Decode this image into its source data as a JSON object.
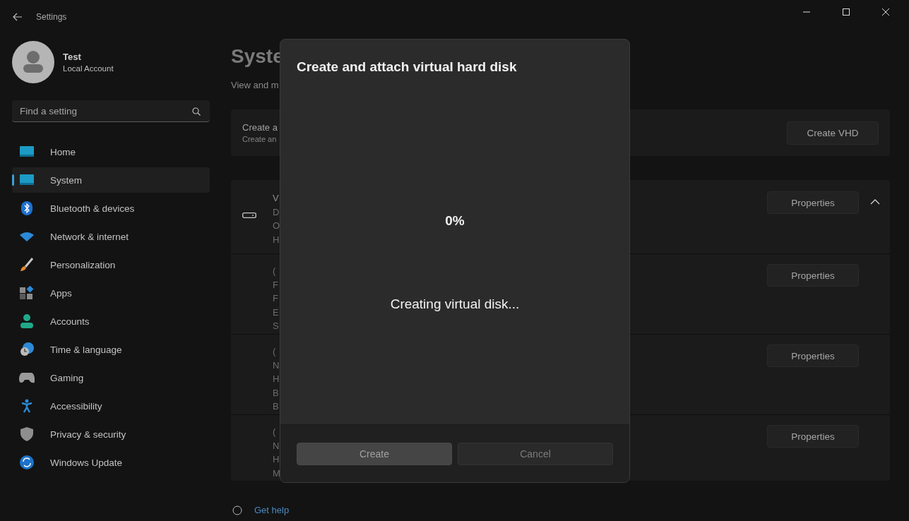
{
  "window": {
    "title": "Settings"
  },
  "profile": {
    "name": "Test",
    "account": "Local Account"
  },
  "search": {
    "placeholder": "Find a setting"
  },
  "nav": [
    {
      "label": "Home",
      "selected": false
    },
    {
      "label": "System",
      "selected": true
    },
    {
      "label": "Bluetooth & devices",
      "selected": false
    },
    {
      "label": "Network & internet",
      "selected": false
    },
    {
      "label": "Personalization",
      "selected": false
    },
    {
      "label": "Apps",
      "selected": false
    },
    {
      "label": "Accounts",
      "selected": false
    },
    {
      "label": "Time & language",
      "selected": false
    },
    {
      "label": "Gaming",
      "selected": false
    },
    {
      "label": "Accessibility",
      "selected": false
    },
    {
      "label": "Privacy & security",
      "selected": false
    },
    {
      "label": "Windows Update",
      "selected": false
    }
  ],
  "page": {
    "title": "Syste",
    "subtitle": "View and m"
  },
  "create_card": {
    "title": "Create a",
    "description": "Create an",
    "button": "Create VHD"
  },
  "disks": {
    "expanded": true,
    "rows": [
      {
        "lines": [
          "V",
          "D",
          "O",
          "H"
        ],
        "button": "Properties"
      },
      {
        "lines": [
          "(",
          "F",
          "F",
          "E",
          "S"
        ],
        "button": "Properties"
      },
      {
        "lines": [
          "(",
          "N",
          "H",
          "B",
          "B"
        ],
        "button": "Properties"
      },
      {
        "lines": [
          "(",
          "N",
          "H",
          "M"
        ],
        "button": "Properties"
      }
    ]
  },
  "help_links": [
    "Get help"
  ],
  "dialog": {
    "title": "Create and attach virtual hard disk",
    "progress": "0%",
    "status": "Creating virtual disk...",
    "buttons": [
      {
        "label": "Create",
        "disabled": true
      },
      {
        "label": "Cancel",
        "disabled": true
      }
    ]
  }
}
